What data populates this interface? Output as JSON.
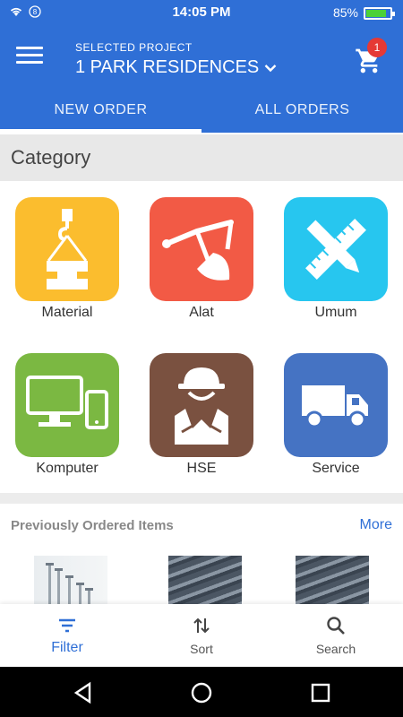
{
  "status_bar": {
    "time": "14:05 PM",
    "battery_percent": "85%",
    "battery_level": 0.85,
    "sim_indicator": "8"
  },
  "header": {
    "selected_project_label": "SELECTED PROJECT",
    "project_name": "1 PARK RESIDENCES",
    "cart_count": "1",
    "tabs": [
      {
        "label": "NEW ORDER",
        "active": true
      },
      {
        "label": "ALL ORDERS",
        "active": false
      }
    ]
  },
  "category": {
    "title": "Category",
    "items": [
      {
        "label": "Material",
        "color": "#fbbd2e",
        "icon": "crane-hook-icon"
      },
      {
        "label": "Alat",
        "color": "#f25a45",
        "icon": "excavator-arm-icon"
      },
      {
        "label": "Umum",
        "color": "#27c6ef",
        "icon": "ruler-pencil-icon"
      },
      {
        "label": "Komputer",
        "color": "#7bb842",
        "icon": "computer-phone-icon"
      },
      {
        "label": "HSE",
        "color": "#7a5140",
        "icon": "safety-worker-icon"
      },
      {
        "label": "Service",
        "color": "#4573c3",
        "icon": "truck-icon"
      }
    ]
  },
  "previously_ordered": {
    "title": "Previously Ordered Items",
    "more_label": "More"
  },
  "bottom_bar": {
    "items": [
      {
        "label": "Filter",
        "icon": "filter-icon",
        "active": true
      },
      {
        "label": "Sort",
        "icon": "sort-icon",
        "active": false
      },
      {
        "label": "Search",
        "icon": "search-icon",
        "active": false
      }
    ]
  },
  "colors": {
    "primary": "#2f6fd6",
    "badge": "#e53935"
  }
}
